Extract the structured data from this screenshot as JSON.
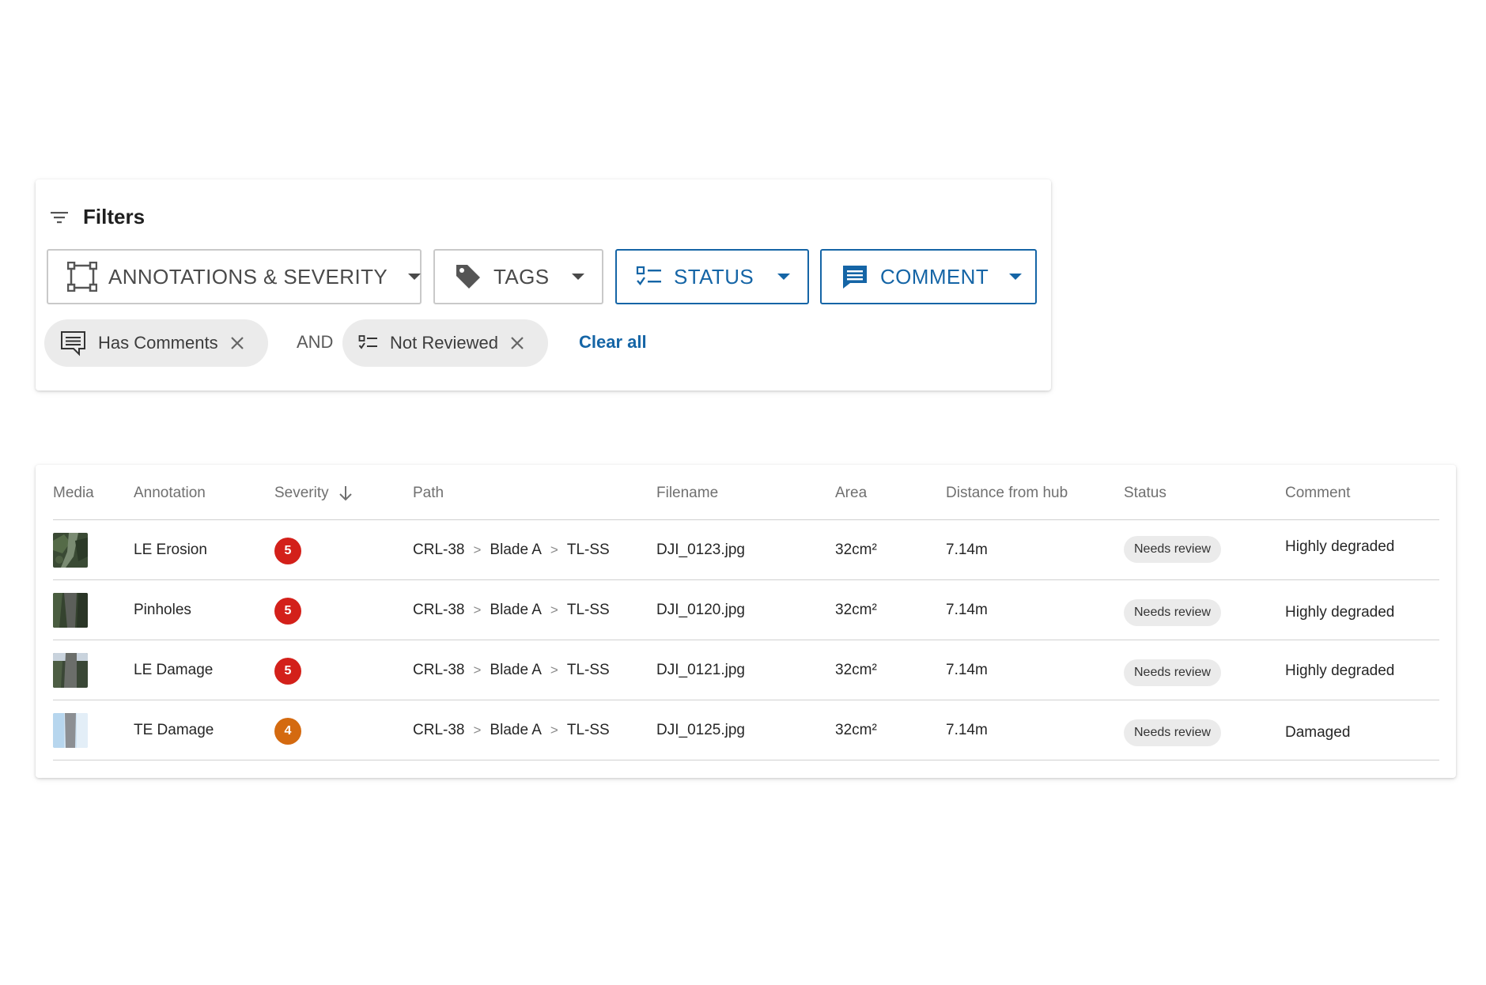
{
  "filters": {
    "title": "Filters",
    "icon": "filter-list-icon",
    "dropdowns": [
      {
        "label": "ANNOTATIONS & SEVERITY",
        "icon": "bounding-box-icon",
        "active": false
      },
      {
        "label": "TAGS",
        "icon": "tag-icon",
        "active": false
      },
      {
        "label": "STATUS",
        "icon": "checklist-icon",
        "active": true
      },
      {
        "label": "COMMENT",
        "icon": "comment-icon",
        "active": true
      }
    ],
    "chips": [
      {
        "label": "Has Comments",
        "icon": "comment-outline-icon"
      },
      {
        "label": "Not Reviewed",
        "icon": "checklist-icon"
      }
    ],
    "operator": "AND",
    "clear_all": "Clear all",
    "accent_color": "#1565a6"
  },
  "table": {
    "columns": [
      "Media",
      "Annotation",
      "Severity",
      "Path",
      "Filename",
      "Area",
      "Distance from hub",
      "Status",
      "Comment"
    ],
    "sort": {
      "column": "Severity",
      "direction": "descending",
      "icon": "arrow-down-icon"
    },
    "rows": [
      {
        "annotation": "LE Erosion",
        "severity": "5",
        "severity_color": "#d3201a",
        "path": [
          "CRL-38",
          "Blade A",
          "TL-SS"
        ],
        "filename": "DJI_0123.jpg",
        "area": "32cm²",
        "distance": "7.14m",
        "status": "Needs review",
        "comment": "Highly degraded"
      },
      {
        "annotation": "Pinholes",
        "severity": "5",
        "severity_color": "#d3201a",
        "path": [
          "CRL-38",
          "Blade A",
          "TL-SS"
        ],
        "filename": "DJI_0120.jpg",
        "area": "32cm²",
        "distance": "7.14m",
        "status": "Needs review",
        "comment": "Highly degraded"
      },
      {
        "annotation": "LE Damage",
        "severity": "5",
        "severity_color": "#d3201a",
        "path": [
          "CRL-38",
          "Blade A",
          "TL-SS"
        ],
        "filename": "DJI_0121.jpg",
        "area": "32cm²",
        "distance": "7.14m",
        "status": "Needs review",
        "comment": "Highly degraded"
      },
      {
        "annotation": "TE Damage",
        "severity": "4",
        "severity_color": "#d46a10",
        "path": [
          "CRL-38",
          "Blade A",
          "TL-SS"
        ],
        "filename": "DJI_0125.jpg",
        "area": "32cm²",
        "distance": "7.14m",
        "status": "Needs review",
        "comment": "Damaged"
      }
    ],
    "path_separator": ">"
  }
}
